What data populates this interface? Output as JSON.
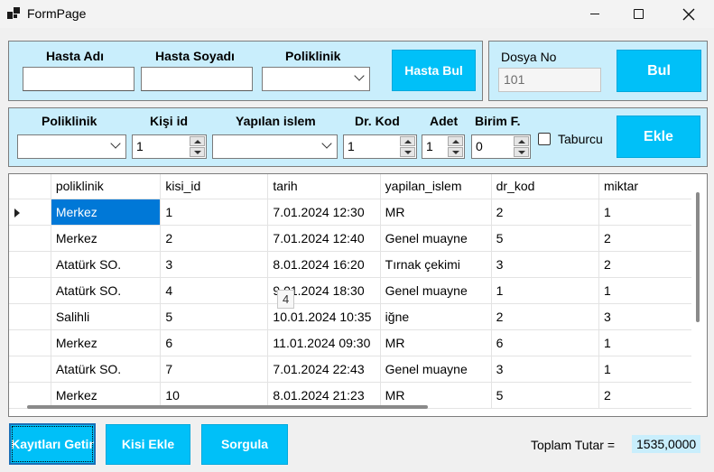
{
  "window": {
    "title": "FormPage"
  },
  "hasta": {
    "ad_label": "Hasta Adı",
    "soyad_label": "Hasta Soyadı",
    "poliklinik_label": "Poliklinik",
    "ad_value": "",
    "soyad_value": "",
    "poliklinik_value": "",
    "find_button": "Hasta Bul"
  },
  "dosya": {
    "label": "Dosya No",
    "value": "101",
    "button": "Bul"
  },
  "islem": {
    "poliklinik_label": "Poliklinik",
    "kisi_label": "Kişi id",
    "yapilan_label": "Yapılan islem",
    "drkod_label": "Dr. Kod",
    "adet_label": "Adet",
    "birim_label": "Birim F.",
    "poliklinik_value": "",
    "kisi_value": "1",
    "yapilan_value": "",
    "drkod_value": "1",
    "adet_value": "1",
    "birim_value": "0",
    "taburcu_label": "Taburcu",
    "add_button": "Ekle"
  },
  "grid": {
    "columns": [
      "poliklinik",
      "kisi_id",
      "tarih",
      "yapilan_islem",
      "dr_kod",
      "miktar"
    ],
    "rows": [
      [
        "Merkez",
        "1",
        "7.01.2024 12:30",
        "MR",
        "2",
        "1"
      ],
      [
        "Merkez",
        "2",
        "7.01.2024 12:40",
        "Genel muayne",
        "5",
        "2"
      ],
      [
        "Atatürk SO.",
        "3",
        "8.01.2024 16:20",
        "Tırnak çekimi",
        "3",
        "2"
      ],
      [
        "Atatürk SO.",
        "4",
        "9.01.2024 18:30",
        "Genel muayne",
        "1",
        "1"
      ],
      [
        "Salihli",
        "5",
        "10.01.2024 10:35",
        "iğne",
        "2",
        "3"
      ],
      [
        "Merkez",
        "6",
        "11.01.2024 09:30",
        "MR",
        "6",
        "1"
      ],
      [
        "Atatürk SO.",
        "7",
        "7.01.2024 22:43",
        "Genel muayne",
        "3",
        "1"
      ],
      [
        "Merkez",
        "10",
        "8.01.2024 21:23",
        "MR",
        "5",
        "2"
      ]
    ],
    "tooltip": "4"
  },
  "footer": {
    "getir_button": "Kayıtları Getir",
    "kisi_ekle_button": "Kisi Ekle",
    "sorgula_button": "Sorgula",
    "total_label": "Toplam Tutar =",
    "total_value": "1535,0000"
  },
  "colors": {
    "accent": "#00c0f8",
    "panel": "#c9eefc",
    "selection": "#0078d7"
  }
}
